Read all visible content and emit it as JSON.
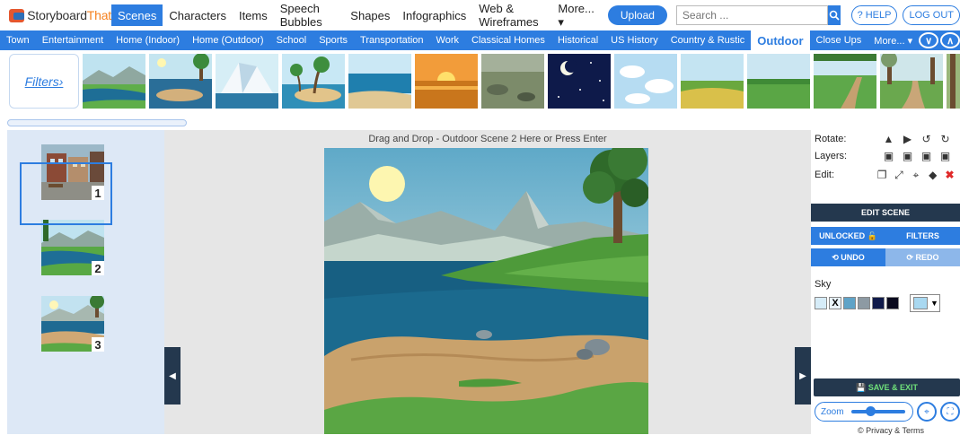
{
  "app": {
    "brand_part1": "Storyboard",
    "brand_part2": "That"
  },
  "nav": {
    "items": [
      "Scenes",
      "Characters",
      "Items",
      "Speech Bubbles",
      "Shapes",
      "Infographics",
      "Web & Wireframes",
      "More... ▾"
    ],
    "active_index": 0,
    "upload_label": "Upload",
    "search_placeholder": "Search ...",
    "help_label": "? HELP",
    "logout_label": "LOG OUT"
  },
  "categories": {
    "items": [
      "Town",
      "Entertainment",
      "Home (Indoor)",
      "Home (Outdoor)",
      "School",
      "Sports",
      "Transportation",
      "Work",
      "Classical Homes",
      "Historical",
      "US History",
      "Country & Rustic",
      "Outdoor",
      "Close Ups",
      "More... ▾"
    ],
    "active_index": 12
  },
  "scene_browser": {
    "filters_label": "Filters›",
    "thumbnails": [
      "river",
      "island-tree",
      "iceberg",
      "palm-island",
      "ocean",
      "sunset",
      "rocky-shore",
      "night-sky",
      "clouds",
      "wheat-field",
      "meadow",
      "forest-path",
      "path-trees",
      "forest-edge"
    ]
  },
  "cells": [
    {
      "number": "1",
      "scene": "town-street"
    },
    {
      "number": "2",
      "scene": "river"
    },
    {
      "number": "3",
      "scene": "outdoor-lake"
    }
  ],
  "editor": {
    "drop_text": "Drag and Drop - Outdoor Scene 2 Here or Press Enter"
  },
  "panel": {
    "rotate_label": "Rotate:",
    "layers_label": "Layers:",
    "edit_label": "Edit:",
    "edit_scene_label": "EDIT SCENE",
    "unlocked_label": "UNLOCKED",
    "filters_label": "FILTERS",
    "undo_label": "UNDO",
    "redo_label": "REDO",
    "sky_label": "Sky",
    "sky_swatches": [
      "#d6ecf8",
      "#eaf4fb",
      "#5fa3c7",
      "#8d9aa3",
      "#101a4a",
      "#0a0a1e"
    ],
    "selected_color": "#a9d8f0",
    "save_exit_label": "SAVE & EXIT",
    "zoom_label": "Zoom",
    "zoom_value": 0.35,
    "footer_label": "© Privacy & Terms"
  }
}
